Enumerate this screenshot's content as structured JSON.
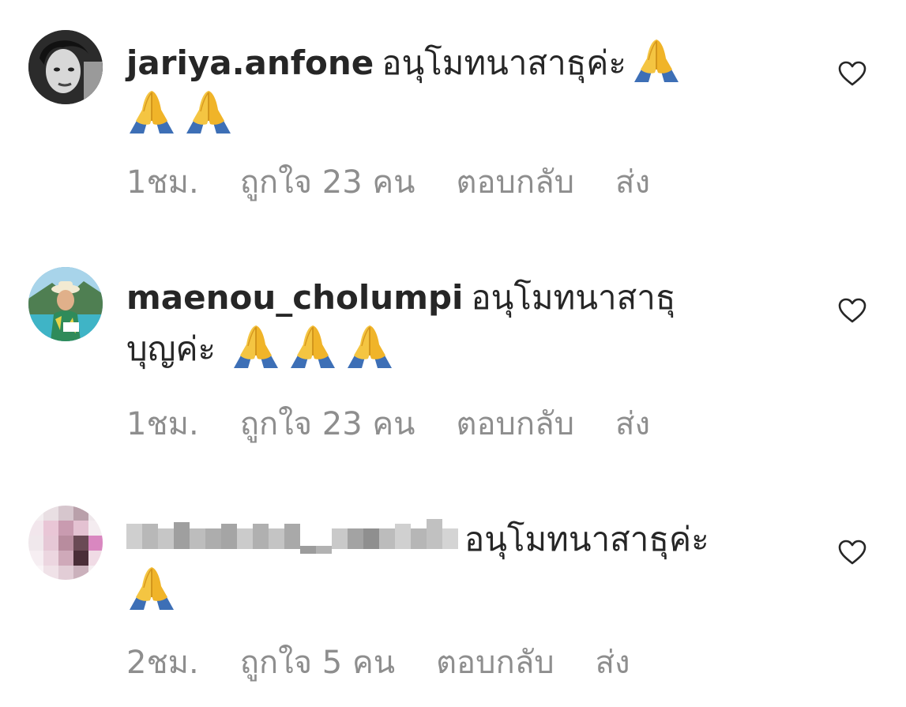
{
  "comments": [
    {
      "username": "jariya.anfone",
      "text": "อนุโมทนาสาธุค่ะ",
      "emoji_count": 3,
      "time": "1ชม.",
      "likes": "ถูกใจ 23 คน",
      "reply": "ตอบกลับ",
      "send": "ส่ง",
      "avatar_icon": "profile-photo-bw"
    },
    {
      "username": "maenou_cholumpi",
      "text": "อนุโมทนาสาธุบุญค่ะ",
      "text_line1": "อนุโมทนาสาธุ",
      "text_line2": "บุญค่ะ",
      "emoji_count": 3,
      "time": "1ชม.",
      "likes": "ถูกใจ 23 คน",
      "reply": "ตอบกลับ",
      "send": "ส่ง",
      "avatar_icon": "profile-photo-beach"
    },
    {
      "username": "",
      "text": "อนุโมทนาสาธุค่ะ",
      "emoji_count": 1,
      "time": "2ชม.",
      "likes": "ถูกใจ 5 คน",
      "reply": "ตอบกลับ",
      "send": "ส่ง",
      "avatar_icon": "pixelated-avatar"
    }
  ],
  "colors": {
    "text": "#262626",
    "meta": "#8e8e8e",
    "heart_outline": "#262626"
  },
  "icons": {
    "emoji": "folded-hands-emoji",
    "like": "heart-outline-icon"
  }
}
